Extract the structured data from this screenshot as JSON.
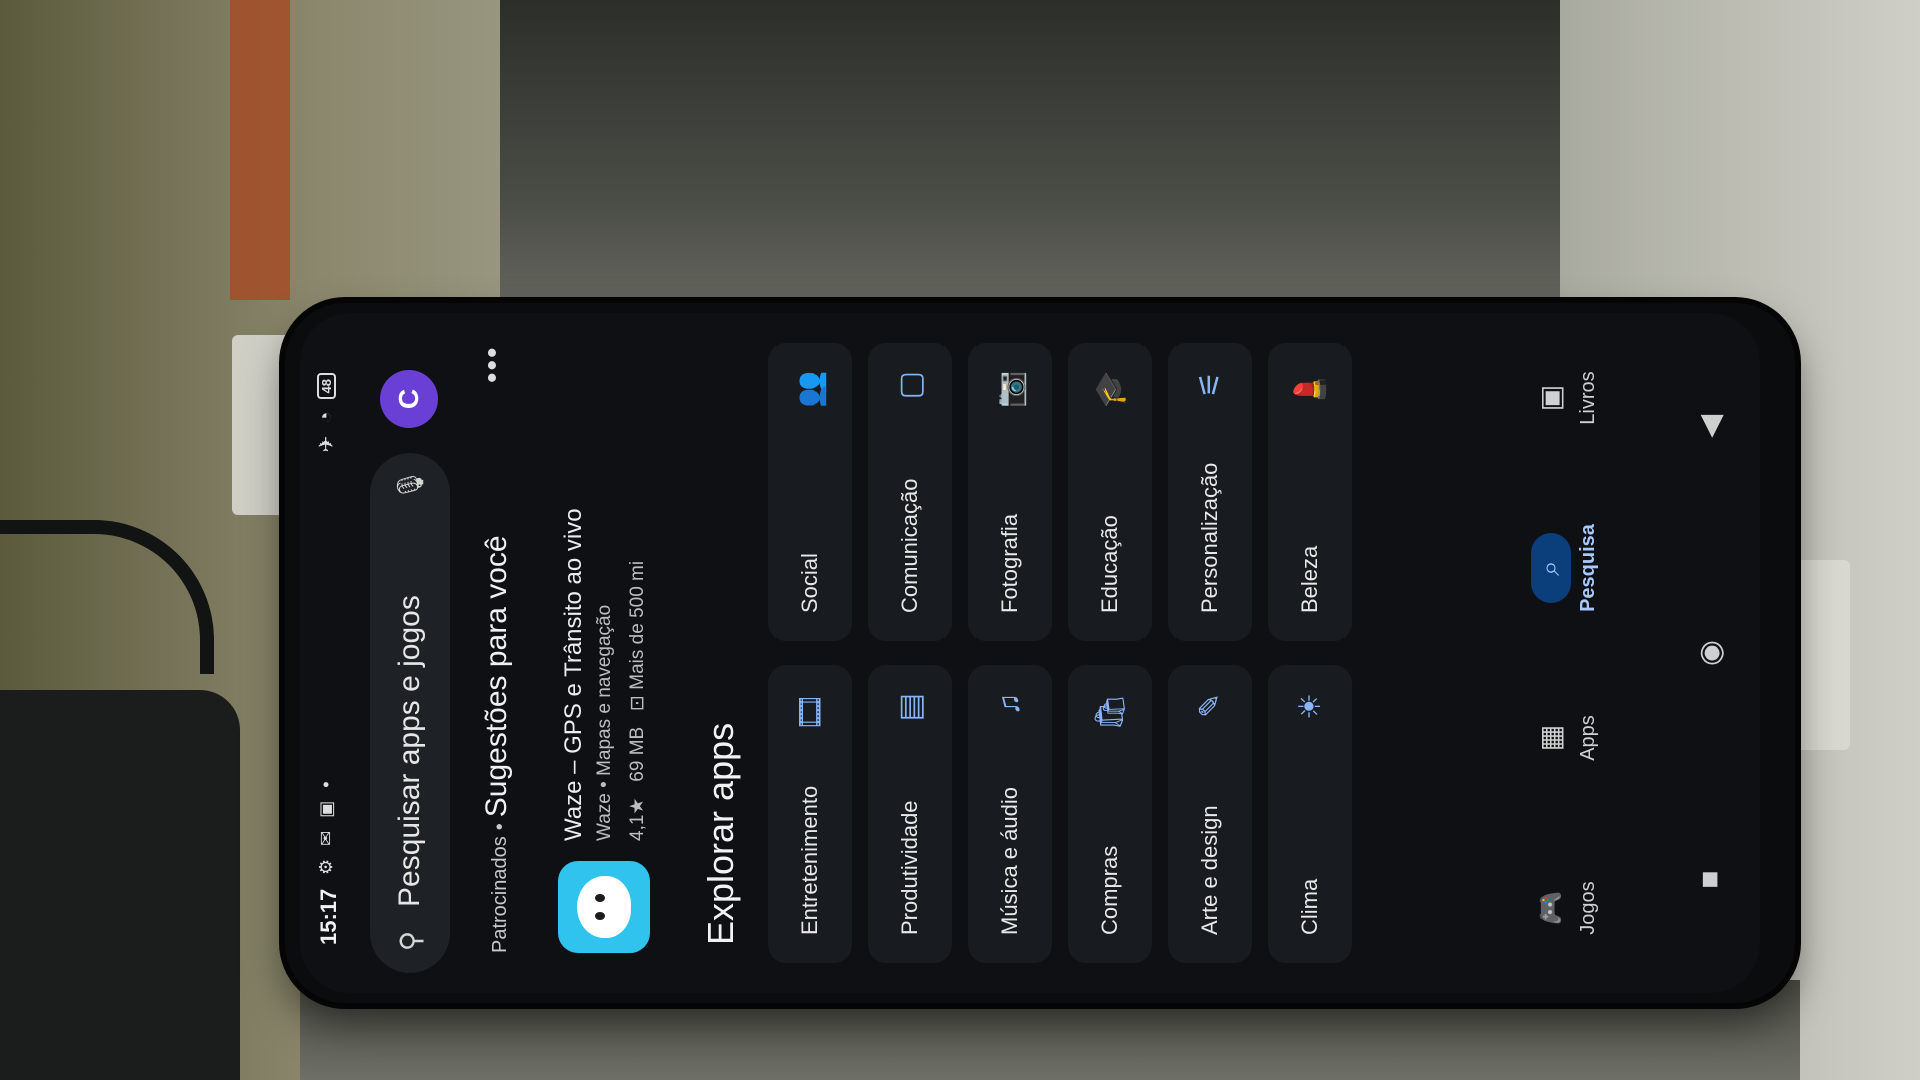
{
  "status_bar": {
    "time": "15:17",
    "icons_left": "⚙ ✉ ▣ •",
    "airplane": "✈",
    "wifi": "◔",
    "battery": "48"
  },
  "search": {
    "placeholder": "Pesquisar apps e jogos",
    "search_icon": "search-icon",
    "mic_icon": "mic-icon"
  },
  "account": {
    "initial": "C",
    "color": "#6a3fd6"
  },
  "sponsored": {
    "label": "Patrocinados",
    "separator": "•",
    "title": "Sugestões para você",
    "more": "•••",
    "app": {
      "name": "Waze – GPS e Trânsito ao vivo",
      "subtitle": "Waze • Mapas e navegação",
      "rating": "4,1★",
      "size": "69 MB",
      "downloads": "Mais de 500 mi"
    }
  },
  "explore": {
    "title": "Explorar apps",
    "categories": [
      {
        "label": "Entretenimento",
        "icon": "🎞"
      },
      {
        "label": "Social",
        "icon": "👥"
      },
      {
        "label": "Produtividade",
        "icon": "▤"
      },
      {
        "label": "Comunicação",
        "icon": "▢"
      },
      {
        "label": "Música e áudio",
        "icon": "♫"
      },
      {
        "label": "Fotografia",
        "icon": "📷"
      },
      {
        "label": "Compras",
        "icon": "🛍"
      },
      {
        "label": "Educação",
        "icon": "🎓"
      },
      {
        "label": "Arte e design",
        "icon": "✎"
      },
      {
        "label": "Personalização",
        "icon": "⚟"
      },
      {
        "label": "Clima",
        "icon": "☀"
      },
      {
        "label": "Beleza",
        "icon": "💄"
      }
    ]
  },
  "bottom_nav": [
    {
      "label": "Jogos",
      "icon": "🎮"
    },
    {
      "label": "Apps",
      "icon": "▦"
    },
    {
      "label": "Pesquisa",
      "icon": "⌕",
      "active": true
    },
    {
      "label": "Livros",
      "icon": "▣"
    }
  ],
  "system_nav": {
    "recents": "■",
    "home": "◉",
    "back": "◀"
  },
  "colors": {
    "accent": "#a8c7fa",
    "active_bg": "#0b3f7c",
    "waze": "#2fc3ee"
  }
}
